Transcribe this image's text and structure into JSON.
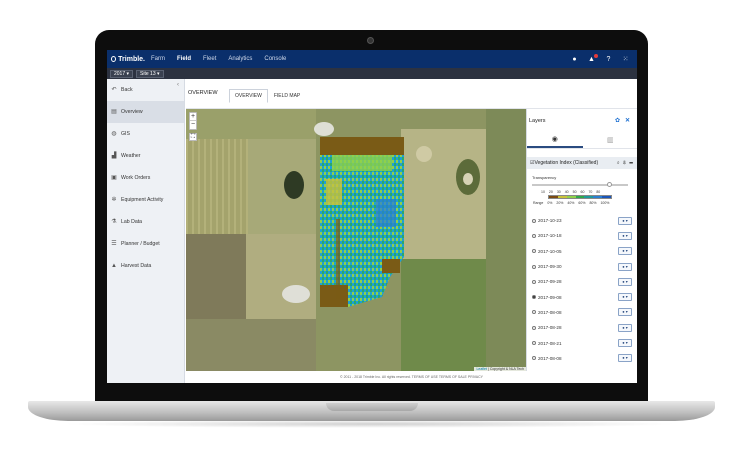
{
  "nav": {
    "brand": "Trimble.",
    "items": [
      "Farm",
      "Field",
      "Fleet",
      "Analytics",
      "Console"
    ],
    "active": "Field"
  },
  "subbar": {
    "year": "2017 ▾",
    "site": "Site 13 ▾"
  },
  "sidebar": {
    "items": [
      {
        "label": "Back",
        "icon": "back-arrow-icon",
        "glyph": "↶"
      },
      {
        "label": "Overview",
        "icon": "book-icon",
        "glyph": "▤"
      },
      {
        "label": "GIS",
        "icon": "globe-icon",
        "glyph": "◍"
      },
      {
        "label": "Weather",
        "icon": "chart-icon",
        "glyph": "▟"
      },
      {
        "label": "Work Orders",
        "icon": "clipboard-icon",
        "glyph": "▣"
      },
      {
        "label": "Equipment Activity",
        "icon": "gear-icon",
        "glyph": "✲"
      },
      {
        "label": "Lab Data",
        "icon": "flask-icon",
        "glyph": "⚗"
      },
      {
        "label": "Planner / Budget",
        "icon": "planner-icon",
        "glyph": "☰"
      },
      {
        "label": "Harvest Data",
        "icon": "harvest-icon",
        "glyph": "▲"
      }
    ]
  },
  "content": {
    "title": "OVERVIEW",
    "tabs": [
      "OVERVIEW",
      "FIELD MAP"
    ]
  },
  "map": {
    "zoom_in": "+",
    "zoom_out": "−",
    "attribution_link": "Leaflet",
    "attribution_text": " | Copyright & NLA Tech"
  },
  "layers": {
    "title": "Layers",
    "vi_label": "Vegetation Index (Classified)",
    "transparency_label": "Transparency",
    "transparency": 0.78,
    "scale_values": [
      "10",
      "20",
      "30",
      "40",
      "50",
      "60",
      "70",
      "80"
    ],
    "scale_colors": [
      "#7a4a12",
      "#c9c23a",
      "#8fd14a",
      "#2fa84a",
      "#1f9a9a",
      "#2a7fd0",
      "#1a55b8"
    ],
    "scale_labels": [
      "Range",
      "0%",
      "20%",
      "40%",
      "60%",
      "80%",
      "100%"
    ],
    "dates": [
      {
        "date": "2017-10-23",
        "selected": false
      },
      {
        "date": "2017-10-18",
        "selected": false
      },
      {
        "date": "2017-10-05",
        "selected": false
      },
      {
        "date": "2017-09-30",
        "selected": false
      },
      {
        "date": "2017-09-28",
        "selected": false
      },
      {
        "date": "2017-09-08",
        "selected": true
      },
      {
        "date": "2017-08-08",
        "selected": false
      },
      {
        "date": "2017-08-28",
        "selected": false
      },
      {
        "date": "2017-08-21",
        "selected": false
      },
      {
        "date": "2017-08-08",
        "selected": false
      }
    ]
  },
  "footer": "© 2011 - 2018 Trimble Inc. All rights reserved.   TERMS OF USE   TERMS OF SALE   PRIVACY"
}
